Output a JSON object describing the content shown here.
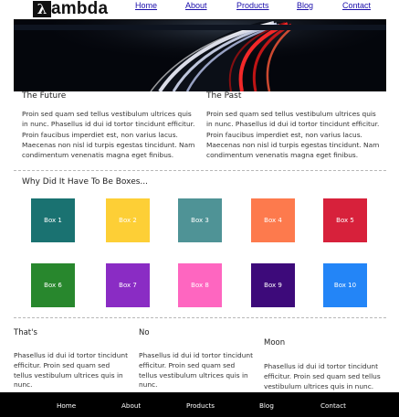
{
  "brand": {
    "mark": "λ",
    "text": "ambda"
  },
  "nav": {
    "items": [
      {
        "label": "Home"
      },
      {
        "label": "About"
      },
      {
        "label": "Products"
      },
      {
        "label": "Blog"
      },
      {
        "label": "Contact"
      }
    ]
  },
  "hero": {
    "image_icon": "highway-light-trails-image"
  },
  "columns": [
    {
      "title": "The Future",
      "text": "Proin sed quam sed tellus vestibulum ultrices quis in nunc. Phasellus id dui id tortor tincidunt efficitur. Proin faucibus imperdiet est, non varius lacus. Maecenas non nisl id turpis egestas tincidunt. Nam condimentum venenatis magna eget finibus."
    },
    {
      "title": "The Past",
      "text": "Proin sed quam sed tellus vestibulum ultrices quis in nunc. Phasellus id dui id tortor tincidunt efficitur. Proin faucibus imperdiet est, non varius lacus. Maecenas non nisl id turpis egestas tincidunt. Nam condimentum venenatis magna eget finibus."
    }
  ],
  "boxes_section": {
    "title": "Why Did It Have To Be Boxes...",
    "boxes": [
      {
        "label": "Box 1",
        "color": "#1a7271"
      },
      {
        "label": "Box 2",
        "color": "#fdcf36"
      },
      {
        "label": "Box 3",
        "color": "#4f9396"
      },
      {
        "label": "Box 4",
        "color": "#fd7a4d"
      },
      {
        "label": "Box 5",
        "color": "#d7213b"
      },
      {
        "label": "Box 6",
        "color": "#28872d"
      },
      {
        "label": "Box 7",
        "color": "#8a2cc4"
      },
      {
        "label": "Box 8",
        "color": "#fe66c0"
      },
      {
        "label": "Box 9",
        "color": "#3d0a7a"
      },
      {
        "label": "Box 10",
        "color": "#2385f7"
      }
    ]
  },
  "bottom_columns": [
    {
      "title": "That's",
      "text": "Phasellus id dui id tortor tincidunt efficitur. Proin sed quam sed tellus vestibulum ultrices quis in nunc."
    },
    {
      "title": "No",
      "text": "Phasellus id dui id tortor tincidunt efficitur. Proin sed quam sed tellus vestibulum ultrices quis in nunc."
    },
    {
      "title": "Moon",
      "text": "Phasellus id dui id tortor tincidunt efficitur. Proin sed quam sed tellus vestibulum ultrices quis in nunc."
    }
  ],
  "footer": {
    "items": [
      {
        "label": "Home"
      },
      {
        "label": "About"
      },
      {
        "label": "Products"
      },
      {
        "label": "Blog"
      },
      {
        "label": "Contact"
      }
    ]
  }
}
